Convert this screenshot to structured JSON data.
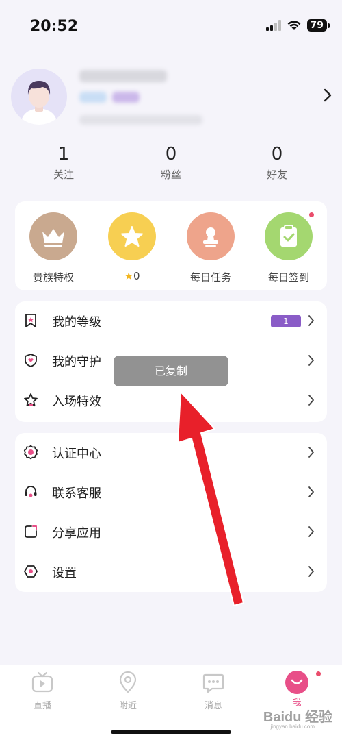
{
  "status_bar": {
    "time": "20:52",
    "battery": "79"
  },
  "stats": [
    {
      "value": "1",
      "label": "关注"
    },
    {
      "value": "0",
      "label": "粉丝"
    },
    {
      "value": "0",
      "label": "好友"
    }
  ],
  "features": [
    {
      "label": "贵族特权",
      "icon": "crown-icon",
      "color": "#c9a98f"
    },
    {
      "label": "0",
      "icon": "star-icon",
      "color": "#f7cf52"
    },
    {
      "label": "每日任务",
      "icon": "stamp-icon",
      "color": "#eea48b"
    },
    {
      "label": "每日签到",
      "icon": "clipboard-check-icon",
      "color": "#a4d770"
    }
  ],
  "menu_group_1": [
    {
      "label": "我的等级",
      "icon": "bookmark-star-icon",
      "badge": "1"
    },
    {
      "label": "我的守护",
      "icon": "shield-heart-icon"
    },
    {
      "label": "入场特效",
      "icon": "star-outline-icon"
    }
  ],
  "menu_group_2": [
    {
      "label": "认证中心",
      "icon": "badge-check-icon"
    },
    {
      "label": "联系客服",
      "icon": "headset-icon"
    },
    {
      "label": "分享应用",
      "icon": "share-icon"
    },
    {
      "label": "设置",
      "icon": "settings-hex-icon"
    }
  ],
  "toast": "已复制",
  "tabs": [
    {
      "label": "直播",
      "icon": "tv-icon"
    },
    {
      "label": "附近",
      "icon": "location-pin-icon"
    },
    {
      "label": "消息",
      "icon": "chat-icon"
    },
    {
      "label": "我",
      "icon": "smile-icon",
      "active": true
    }
  ],
  "watermark": {
    "text": "Baidu 经验",
    "sub": "jingyan.baidu.com"
  },
  "colors": {
    "accent": "#e84f88",
    "level_badge": "#8a5cc7",
    "arrow": "#e8202a"
  }
}
